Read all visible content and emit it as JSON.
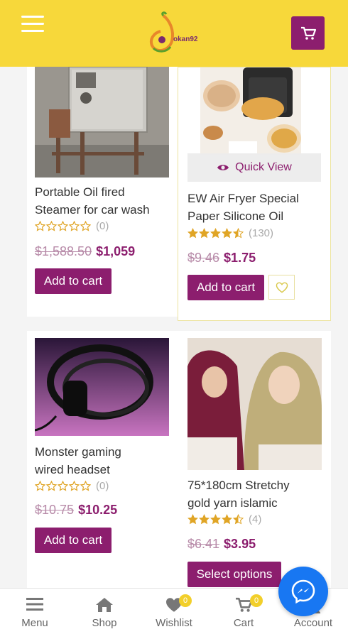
{
  "header": {
    "logo_text": "okan92",
    "brand_color": "#8c1e6e",
    "header_color": "#f7d83a"
  },
  "quick_view_label": "Quick View",
  "products": [
    {
      "name_line1": "Portable Oil fired",
      "name_line2": "Steamer for car wash",
      "rating": 0,
      "rating_count": "(0)",
      "old_price": "$1,588.50",
      "new_price": "$1,059",
      "button": "Add to cart"
    },
    {
      "name_line1": "EW Air Fryer Special",
      "name_line2": "Paper Silicone Oil",
      "rating": 4.5,
      "rating_count": "(130)",
      "old_price": "$9.46",
      "new_price": "$1.75",
      "button": "Add to cart"
    },
    {
      "name_line1": "Monster gaming",
      "name_line2": "wired headset",
      "rating": 0,
      "rating_count": "(0)",
      "old_price": "$10.75",
      "new_price": "$10.25",
      "button": "Add to cart"
    },
    {
      "name_line1": "75*180cm Stretchy",
      "name_line2": "gold yarn islamic",
      "rating": 4.5,
      "rating_count": "(4)",
      "old_price": "$6.41",
      "new_price": "$3.95",
      "button": "Select options"
    }
  ],
  "bottom_nav": [
    {
      "label": "Menu",
      "icon": "menu-icon"
    },
    {
      "label": "Shop",
      "icon": "home-icon"
    },
    {
      "label": "Wishlist",
      "icon": "heart-icon",
      "badge": "0"
    },
    {
      "label": "Cart",
      "icon": "cart-icon",
      "badge": "0"
    },
    {
      "label": "Account",
      "icon": "user-icon"
    }
  ]
}
